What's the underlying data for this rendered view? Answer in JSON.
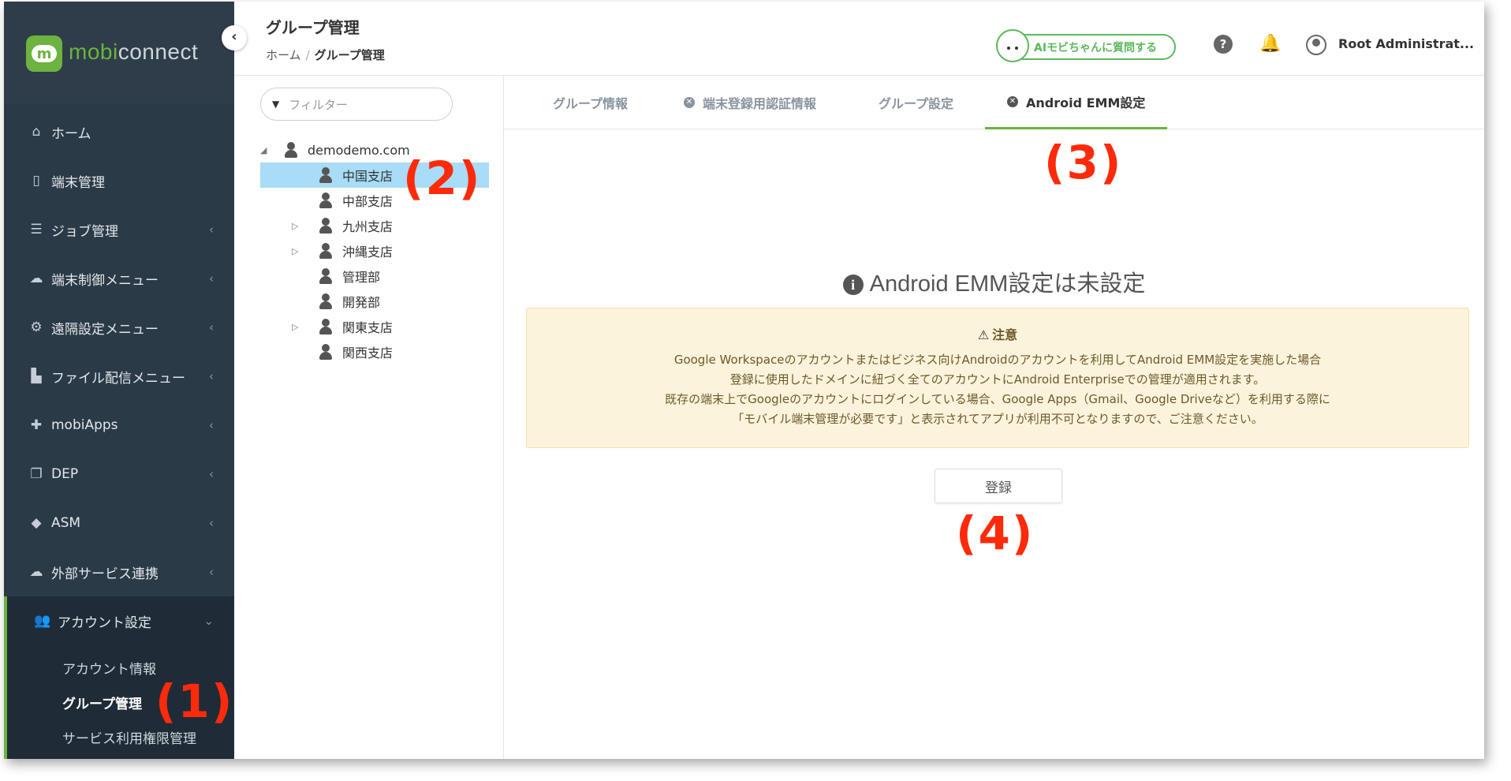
{
  "sidebar": {
    "logo": {
      "mark": "m",
      "text_a": "mobi",
      "text_b": "connect"
    },
    "collapse_icon": "chevron-left-icon",
    "items": [
      {
        "label": "ホーム",
        "icon": "home-icon"
      },
      {
        "label": "端末管理",
        "icon": "device-icon"
      },
      {
        "label": "ジョブ管理",
        "icon": "server-icon"
      },
      {
        "label": "端末制御メニュー",
        "icon": "cloud-icon"
      },
      {
        "label": "遠隔設定メニュー",
        "icon": "gears-icon"
      },
      {
        "label": "ファイル配信メニュー",
        "icon": "file-icon"
      },
      {
        "label": "mobiApps",
        "icon": "puzzle-icon"
      },
      {
        "label": "DEP",
        "icon": "copy-icon"
      },
      {
        "label": "ASM",
        "icon": "graduation-cap-icon"
      },
      {
        "label": "外部サービス連携",
        "icon": "cloud-solid-icon"
      },
      {
        "label": "アカウント設定",
        "icon": "users-icon"
      }
    ],
    "sub_items": [
      {
        "label": "アカウント情報"
      },
      {
        "label": "グループ管理"
      },
      {
        "label": "サービス利用権限管理"
      }
    ]
  },
  "header": {
    "title": "グループ管理",
    "breadcrumb": {
      "home": "ホーム",
      "sep": "/",
      "current": "グループ管理"
    },
    "ai_button": "AIモビちゃんに質問する",
    "help_icon": "?",
    "bell_icon": "🔔",
    "user_name": "Root Administrat..."
  },
  "tree": {
    "filter_placeholder": "フィルター",
    "root": "demodemo.com",
    "nodes": [
      {
        "label": "中国支店"
      },
      {
        "label": "中部支店"
      },
      {
        "label": "九州支店"
      },
      {
        "label": "沖縄支店"
      },
      {
        "label": "管理部"
      },
      {
        "label": "開発部"
      },
      {
        "label": "関東支店"
      },
      {
        "label": "関西支店"
      }
    ]
  },
  "tabs": [
    {
      "label": "グループ情報"
    },
    {
      "label": "端末登録用認証情報"
    },
    {
      "label": "グループ設定"
    },
    {
      "label": "Android EMM設定"
    }
  ],
  "main": {
    "notset_title": "Android EMM設定は未設定",
    "warning": {
      "title": "注意",
      "lines": [
        "Google Workspaceのアカウントまたはビジネス向けAndroidのアカウントを利用してAndroid EMM設定を実施した場合",
        "登録に使用したドメインに紐づく全てのアカウントにAndroid Enterpriseでの管理が適用されます。",
        "既存の端末上でGoogleのアカウントにログインしている場合、Google Apps（Gmail、Google Driveなど）を利用する際に",
        "「モバイル端末管理が必要です」と表示されてアプリが利用不可となりますので、ご注意ください。"
      ]
    },
    "register_button": "登録"
  },
  "annotations": {
    "a1": "(1)",
    "a2": "(2)",
    "a3": "(3)",
    "a4": "(4)"
  },
  "colors": {
    "brand_green": "#6cb33f",
    "sidebar_bg": "#2b3a47",
    "selection": "#a8dcf7",
    "annotation_red": "#ff2a0a",
    "warning_bg": "#fcf3dc"
  }
}
